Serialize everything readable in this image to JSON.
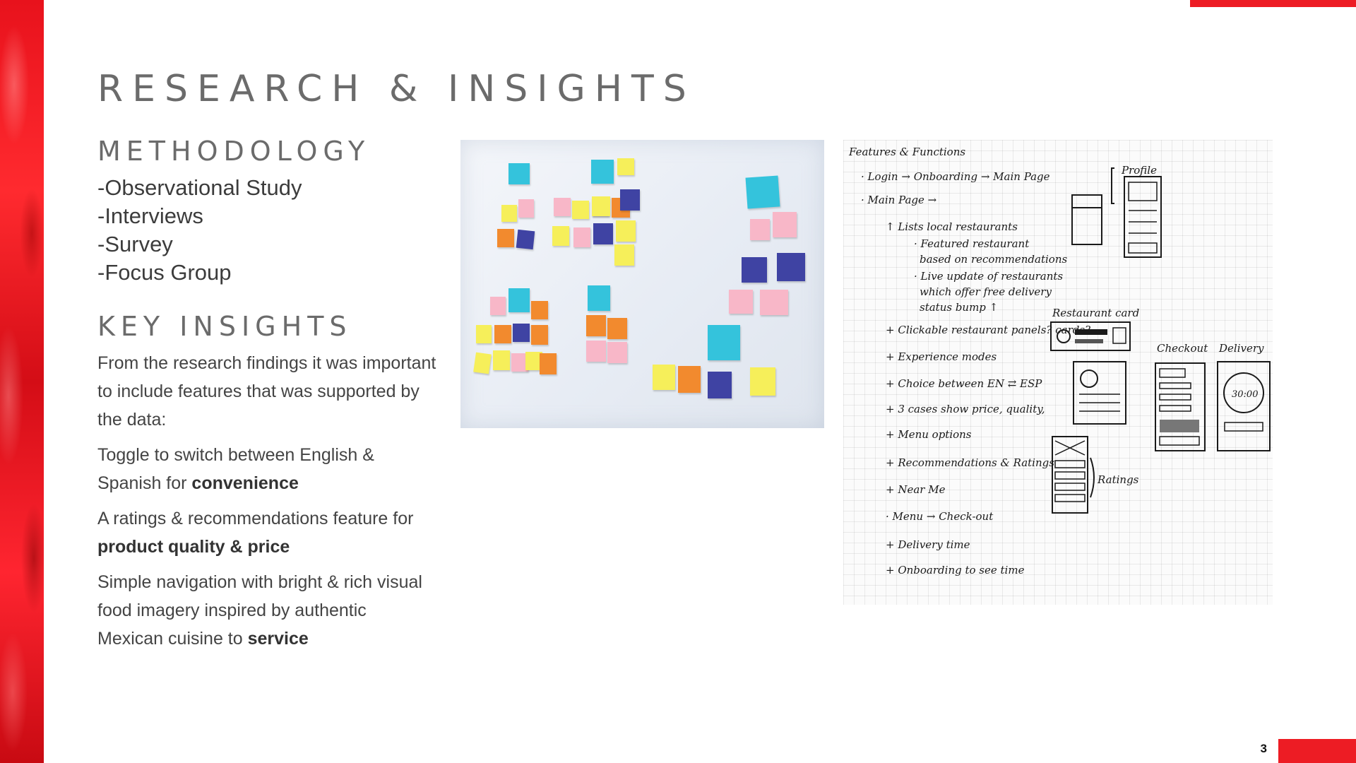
{
  "title": "RESEARCH & INSIGHTS",
  "methodology": {
    "heading": "METHODOLOGY",
    "items": [
      "-Observational Study",
      "-Interviews",
      "-Survey",
      "-Focus Group"
    ]
  },
  "key_insights": {
    "heading": "KEY INSIGHTS",
    "intro": "From the research findings it was important to include features that was supported by the data:",
    "points": [
      {
        "text": "Toggle to switch between English & Spanish for ",
        "bold": "convenience"
      },
      {
        "text": "A ratings & recommendations feature for ",
        "bold": "product quality & price"
      },
      {
        "text": "Simple navigation with bright & rich visual food imagery inspired by authentic Mexican cuisine to ",
        "bold": "service"
      }
    ]
  },
  "page_number": "3",
  "colors": {
    "accent_red": "#ed1c24",
    "heading_gray": "#6b6b6b",
    "body_text": "#444444"
  },
  "images": {
    "sticky_notes_photo": "sticky-notes-whiteboard",
    "sketch": "hand-drawn-wireframe-sketch"
  },
  "sketch_text": {
    "heading": "Features & Functions",
    "lines": [
      "· Login → Onboarding → Main Page",
      "· Main Page →",
      "↑ Lists local restaurants",
      "· Featured restaurant",
      "based on recommendations",
      "· Live update of restaurants",
      "which offer free delivery",
      "status bump ↑",
      "+ Clickable restaurant panels? cards?",
      "+ Experience modes",
      "+ Choice between EN ⇄ ESP",
      "+ 3 cases show price, quality,",
      "+ Menu options",
      "+ Recommendations & Ratings",
      "+ Near Me",
      "· Menu → Check-out",
      "+ Delivery time",
      "+ Onboarding to see time"
    ],
    "labels": [
      "Profile",
      "Restaurant card",
      "Checkout",
      "Delivery",
      "Ratings",
      "30:00"
    ]
  }
}
